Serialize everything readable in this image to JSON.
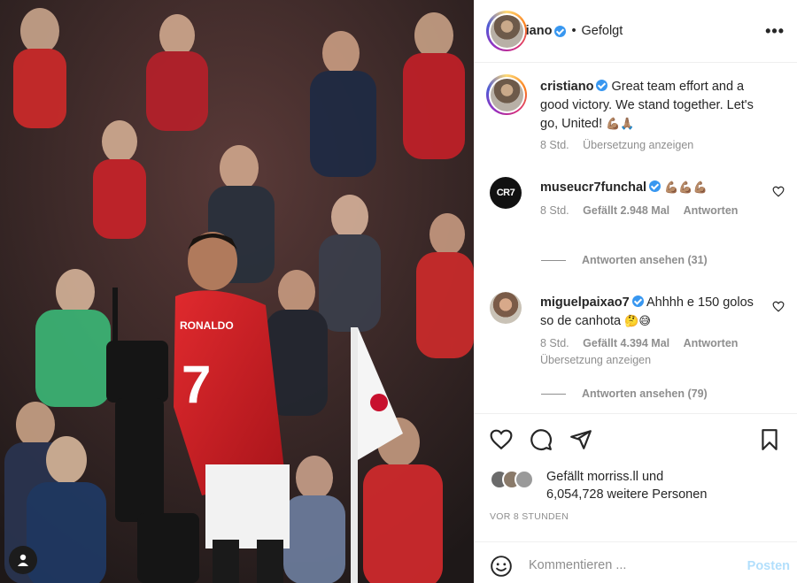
{
  "photo": {
    "alt_icon": "profile-avatar-icon",
    "jersey_name": "RONALDO",
    "jersey_number": "7"
  },
  "post": {
    "author": "cristiano",
    "follow_status": "Gefolgt",
    "more_icon": "more-icon"
  },
  "caption": {
    "author": "cristiano",
    "text": "Great team effort and a good victory. We stand together. Let's go, United!",
    "emoji": "💪🏽🙏🏽",
    "time": "8 Std.",
    "translate": "Übersetzung anzeigen"
  },
  "comments": [
    {
      "author": "museucr7funchal",
      "avatar_text": "CR7",
      "text": "",
      "emoji": "💪🏽💪🏽💪🏽",
      "time": "8 Std.",
      "likes": "Gefällt 2.948 Mal",
      "reply": "Antworten",
      "view_replies": "Antworten ansehen (31)"
    },
    {
      "author": "miguelpaixao7",
      "text": "Ahhhh e 150 golos so de canhota",
      "emoji": "🤔😅",
      "time": "8 Std.",
      "likes": "Gefällt 4.394 Mal",
      "reply": "Antworten",
      "translate": "Übersetzung anzeigen",
      "view_replies": "Antworten ansehen (79)"
    }
  ],
  "actions": {
    "like_icon": "heart-icon",
    "comment_icon": "comment-icon",
    "share_icon": "share-icon",
    "save_icon": "bookmark-icon"
  },
  "likes": {
    "line1_prefix": "Gefällt",
    "liker": "morriss.ll",
    "line1_suffix": "und",
    "line2": "6,054,728 weitere Personen"
  },
  "timestamp": "VOR 8 STUNDEN",
  "comment_input": {
    "placeholder": "Kommentieren ...",
    "post_label": "Posten"
  },
  "colors": {
    "verified": "#3897f0",
    "post_button_disabled": "#b2dffc",
    "jersey_red": "#d41f24",
    "muted_text": "#8e8e8e"
  }
}
